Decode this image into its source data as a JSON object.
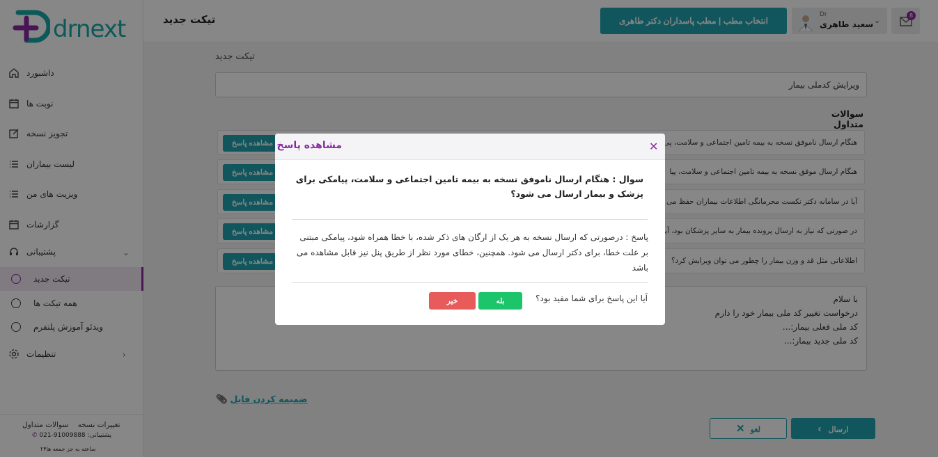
{
  "app": {
    "brand": "drnext"
  },
  "sidebar": {
    "items": [
      {
        "label": "داشبورد",
        "icon": "home-icon"
      },
      {
        "label": "نوبت ها",
        "icon": "calendar-icon"
      },
      {
        "label": "تجویز نسخه",
        "icon": "edit-icon"
      },
      {
        "label": "لیست بیماران",
        "icon": "list-icon"
      },
      {
        "label": "ویزیت های من",
        "icon": "list-icon"
      },
      {
        "label": "گزارشات",
        "icon": "calendar-icon"
      },
      {
        "label": "پشتیبانی",
        "icon": "headset-icon"
      },
      {
        "label": "تنظیمات",
        "icon": "gear-icon"
      }
    ],
    "support_sub": [
      {
        "label": "تیکت جدید",
        "active": true
      },
      {
        "label": "همه تیکت ها",
        "active": false
      },
      {
        "label": "ویدئو آموزش پلتفرم",
        "active": false
      }
    ],
    "footer": {
      "link1": "سوالات متداول",
      "link2": "تغییرات نسخه",
      "phone": "021-91009888 :پشتیبانی",
      "hours": "۲۴ساعته به جز جمعه ها"
    }
  },
  "header": {
    "title": "تیکت جدید",
    "clinic_button": "انتخاب مطب | مطب پاسداران دکتر طاهری",
    "user_prefix": "Dr",
    "user_name": "سعید طاهری",
    "mail_badge": "8"
  },
  "main": {
    "label": "تیکت جدید",
    "subject_value": "ویرایش کدملی بیمار",
    "faq_title": "سوالات متداول",
    "faq_button_label": "مشاهده پاسخ",
    "faq": [
      "هنگام ارسال ناموفق نسخه به بیمه تامین اجتماعی و سلامت، پی",
      "هنگام ارسال موفق نسخه به بیمه تامین اجتماعی و سلامت، پیا",
      "آیا در سامانه دکتر نکست محرمانگی اطلاعات بیماران حفظ می",
      "در صورتی که نیاز به ارسال پرونده بیمار به سایر پزشکان بود، آیا",
      "اطلاعاتی مثل قد و وزن بیمار را چطور می توان ویرایش کرد؟"
    ],
    "message_lines": [
      "با سلام",
      "درخواست تغییر کد ملی بیمار خود را دارم",
      "کد ملی فعلی بیمار:...",
      "کد ملی جدید بیمار:..."
    ],
    "attach_label": "ضمیمه کردن فایل",
    "cancel_label": "لغو",
    "send_label": "ارسال"
  },
  "modal": {
    "title": "مشاهده پاسخ",
    "question": "سوال : هنگام ارسال ناموفق نسخه به بیمه تامین اجتماعی و سلامت، پیامکی برای پزشک و بیمار ارسال می شود؟",
    "answer": "پاسخ : درصورتی که ارسال نسخه به هر یک از ارگان های ذکر شده، با خطا همراه شود، پیامکی مبتنی بر علت خطا، برای دکتر ارسال می شود. همچنین، خطای مورد نظر از طریق پنل نیز قابل مشاهده می باشد",
    "helpful_question": "آیا این پاسخ برای شما مفید بود؟",
    "yes_label": "بله",
    "no_label": "خیر"
  },
  "colors": {
    "accent": "#1fa3ae",
    "purple": "#8a2aa0",
    "success": "#1cc46a",
    "danger": "#e85b5b"
  }
}
